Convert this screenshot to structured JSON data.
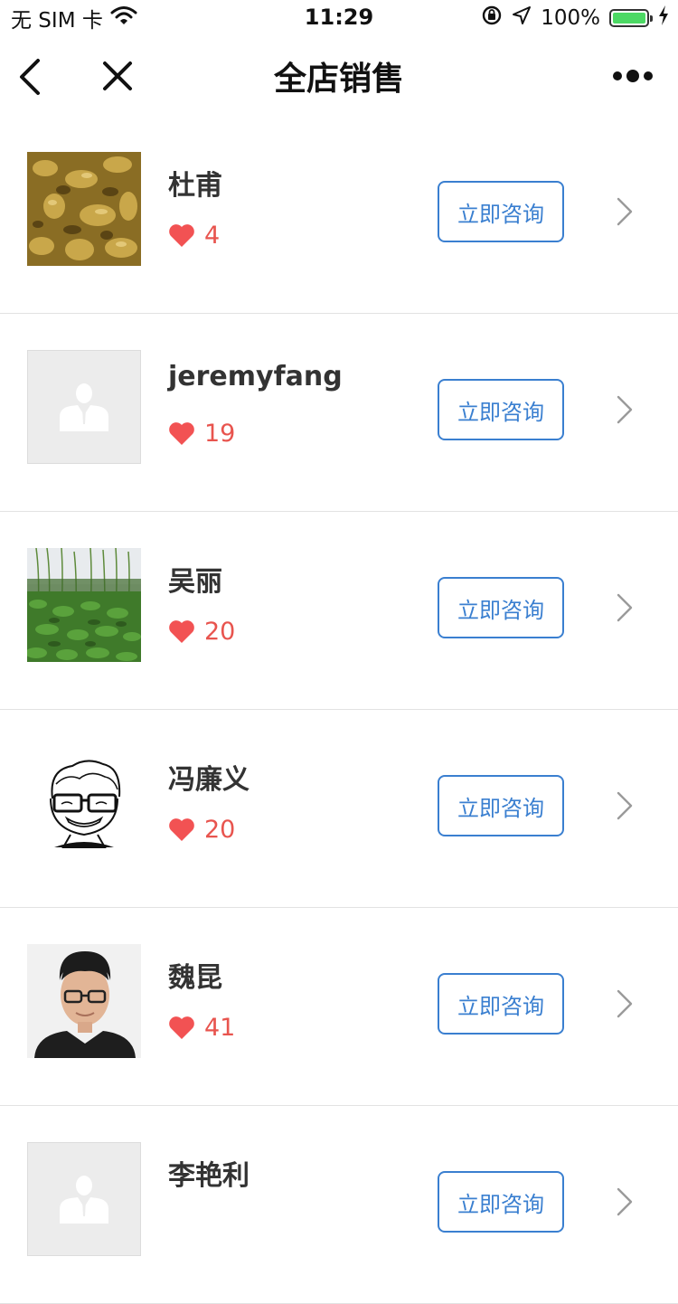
{
  "status_bar": {
    "carrier": "无 SIM 卡",
    "time": "11:29",
    "battery_percent": "100%",
    "battery_level": 1.0,
    "battery_color": "#4cd964"
  },
  "nav": {
    "title": "全店销售",
    "back_icon": "chevron-left-icon",
    "close_icon": "close-icon",
    "more_icon": "more-dots-icon"
  },
  "colors": {
    "accent": "#3a7fd0",
    "like": "#f25253",
    "divider": "#e2e2e2"
  },
  "contacts": [
    {
      "name": "杜甫",
      "likes": "4",
      "button": "立即咨询",
      "avatar": "gold-texture-photo"
    },
    {
      "name": "jeremyfang",
      "likes": "19",
      "button": "立即咨询",
      "avatar": "default-person-placeholder"
    },
    {
      "name": "吴丽",
      "likes": "20",
      "button": "立即咨询",
      "avatar": "lotus-pond-photo"
    },
    {
      "name": "冯廉义",
      "likes": "20",
      "button": "立即咨询",
      "avatar": "cartoon-glasses-sketch"
    },
    {
      "name": "魏昆",
      "likes": "41",
      "button": "立即咨询",
      "avatar": "man-portrait-photo"
    },
    {
      "name": "李艳利",
      "likes": "",
      "button": "立即咨询",
      "avatar": "default-person-placeholder"
    }
  ]
}
